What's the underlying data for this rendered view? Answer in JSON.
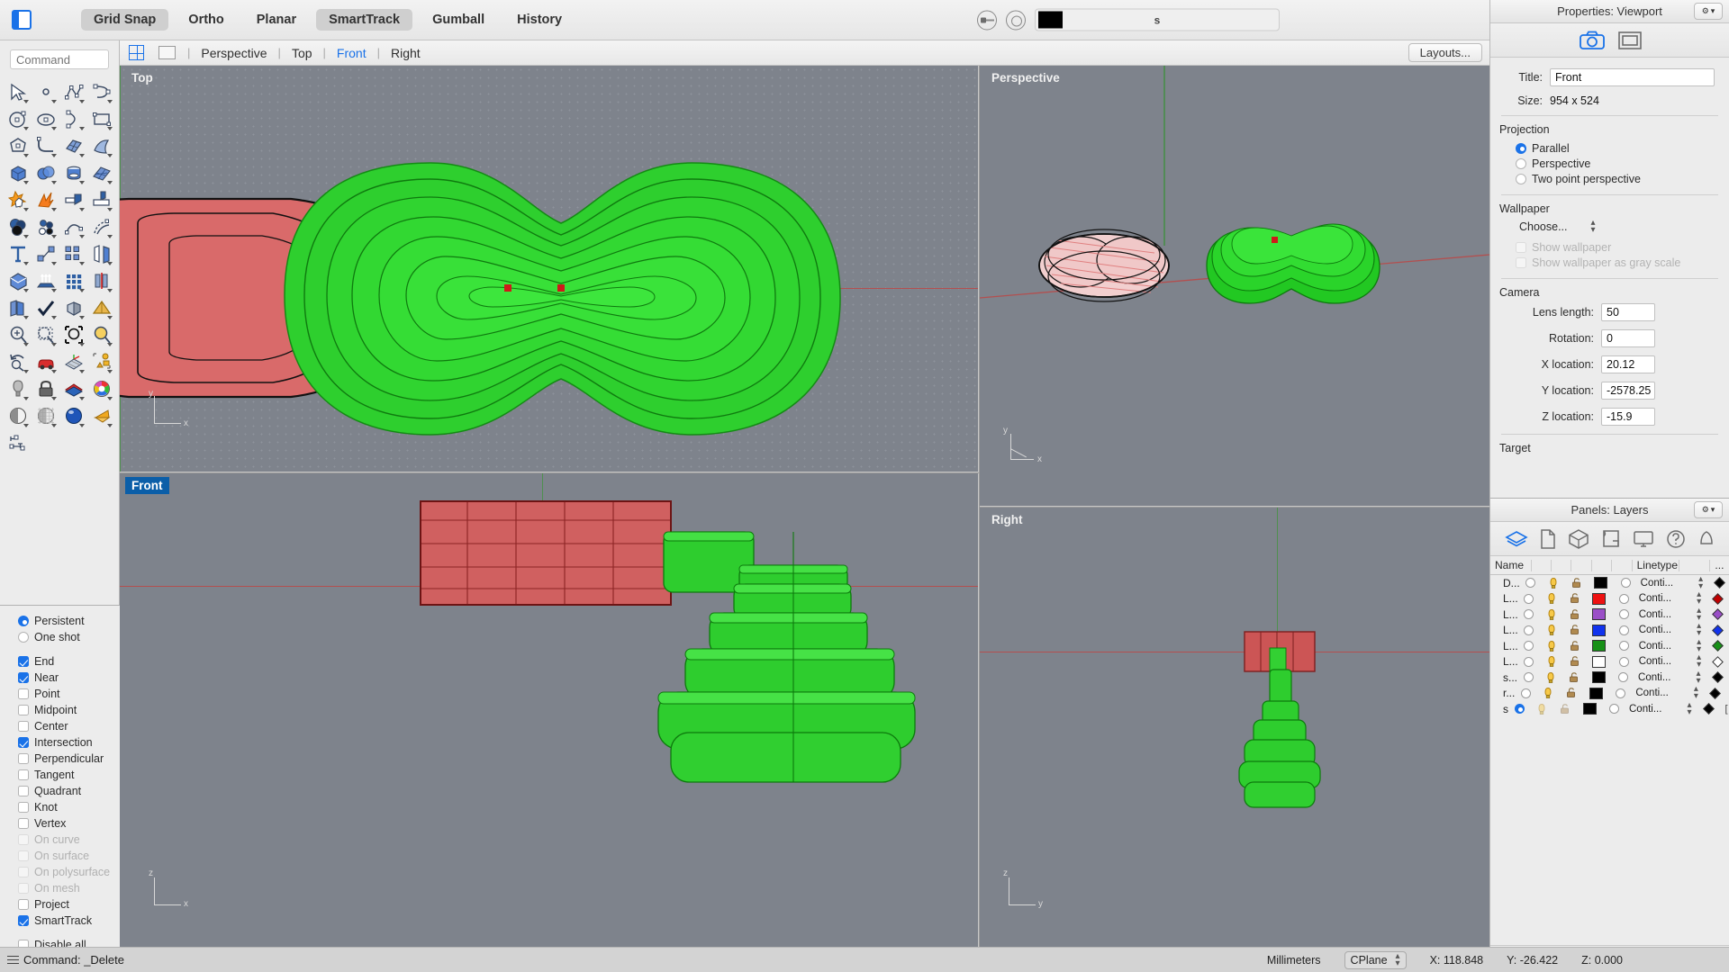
{
  "topbar": {
    "modes": [
      {
        "label": "Grid Snap",
        "active": true
      },
      {
        "label": "Ortho",
        "active": false
      },
      {
        "label": "Planar",
        "active": false
      },
      {
        "label": "SmartTrack",
        "active": true
      },
      {
        "label": "Gumball",
        "active": false
      },
      {
        "label": "History",
        "active": false
      }
    ],
    "current_layer": "s",
    "current_layer_color": "#000000"
  },
  "viewport_tabs": {
    "items": [
      {
        "label": "Perspective",
        "active": false
      },
      {
        "label": "Top",
        "active": false
      },
      {
        "label": "Front",
        "active": true
      },
      {
        "label": "Right",
        "active": false
      }
    ],
    "layouts_label": "Layouts..."
  },
  "command": {
    "placeholder": "Command",
    "value": ""
  },
  "viewports": [
    {
      "label": "Top",
      "active": false
    },
    {
      "label": "Perspective",
      "active": false
    },
    {
      "label": "Front",
      "active": true
    },
    {
      "label": "Right",
      "active": false
    }
  ],
  "osnap": {
    "mode_options": [
      {
        "label": "Persistent",
        "selected": true
      },
      {
        "label": "One shot",
        "selected": false
      }
    ],
    "snaps": [
      {
        "label": "End",
        "checked": true,
        "disabled": false
      },
      {
        "label": "Near",
        "checked": true,
        "disabled": false
      },
      {
        "label": "Point",
        "checked": false,
        "disabled": false
      },
      {
        "label": "Midpoint",
        "checked": false,
        "disabled": false
      },
      {
        "label": "Center",
        "checked": false,
        "disabled": false
      },
      {
        "label": "Intersection",
        "checked": true,
        "disabled": false
      },
      {
        "label": "Perpendicular",
        "checked": false,
        "disabled": false
      },
      {
        "label": "Tangent",
        "checked": false,
        "disabled": false
      },
      {
        "label": "Quadrant",
        "checked": false,
        "disabled": false
      },
      {
        "label": "Knot",
        "checked": false,
        "disabled": false
      },
      {
        "label": "Vertex",
        "checked": false,
        "disabled": false
      },
      {
        "label": "On curve",
        "checked": false,
        "disabled": true
      },
      {
        "label": "On surface",
        "checked": false,
        "disabled": true
      },
      {
        "label": "On polysurface",
        "checked": false,
        "disabled": true
      },
      {
        "label": "On mesh",
        "checked": false,
        "disabled": true
      },
      {
        "label": "Project",
        "checked": false,
        "disabled": false
      },
      {
        "label": "SmartTrack",
        "checked": true,
        "disabled": false
      },
      {
        "label": "Disable all",
        "checked": false,
        "disabled": false
      }
    ]
  },
  "properties": {
    "header": "Properties: Viewport",
    "title_label": "Title:",
    "title_value": "Front",
    "size_label": "Size:",
    "size_value": "954 x 524",
    "projection_heading": "Projection",
    "projection_options": [
      {
        "label": "Parallel",
        "selected": true
      },
      {
        "label": "Perspective",
        "selected": false
      },
      {
        "label": "Two point perspective",
        "selected": false
      }
    ],
    "wallpaper_heading": "Wallpaper",
    "wallpaper_choose": "Choose...",
    "wallpaper_checks": [
      {
        "label": "Show wallpaper",
        "checked": false
      },
      {
        "label": "Show wallpaper as gray scale",
        "checked": false
      }
    ],
    "camera_heading": "Camera",
    "camera_fields": [
      {
        "label": "Lens length:",
        "value": "50"
      },
      {
        "label": "Rotation:",
        "value": "0"
      },
      {
        "label": "X location:",
        "value": "20.12"
      },
      {
        "label": "Y location:",
        "value": "-2578.25"
      },
      {
        "label": "Z location:",
        "value": "-15.9"
      }
    ],
    "target_heading": "Target"
  },
  "layers": {
    "header": "Panels: Layers",
    "columns": {
      "name": "Name",
      "linetype": "Linetype",
      "more": "..."
    },
    "rows": [
      {
        "name": "D...",
        "current": false,
        "color": "#000000",
        "linetype": "Conti...",
        "print_color": "#000000"
      },
      {
        "name": "L...",
        "current": false,
        "color": "#ee1111",
        "linetype": "Conti...",
        "print_color": "#c00000"
      },
      {
        "name": "L...",
        "current": false,
        "color": "#9a4fc7",
        "linetype": "Conti...",
        "print_color": "#9a4fc7"
      },
      {
        "name": "L...",
        "current": false,
        "color": "#1133ee",
        "linetype": "Conti...",
        "print_color": "#1133ee"
      },
      {
        "name": "L...",
        "current": false,
        "color": "#179017",
        "linetype": "Conti...",
        "print_color": "#179017"
      },
      {
        "name": "L...",
        "current": false,
        "color": "#ffffff",
        "linetype": "Conti...",
        "print_color": "#ffffff"
      },
      {
        "name": "s...",
        "current": false,
        "color": "#000000",
        "linetype": "Conti...",
        "print_color": "#000000"
      },
      {
        "name": "r...",
        "current": false,
        "color": "#000000",
        "linetype": "Conti...",
        "print_color": "#000000"
      },
      {
        "name": "s",
        "current": true,
        "color": "#000000",
        "linetype": "Conti...",
        "print_color": "#000000"
      }
    ],
    "footer": {
      "add": "+",
      "remove": "−"
    }
  },
  "statusbar": {
    "command_text": "Command: _Delete",
    "units": "Millimeters",
    "cplane": "CPlane",
    "x": "X: 118.848",
    "y": "Y: -26.422",
    "z": "Z: 0.000"
  }
}
